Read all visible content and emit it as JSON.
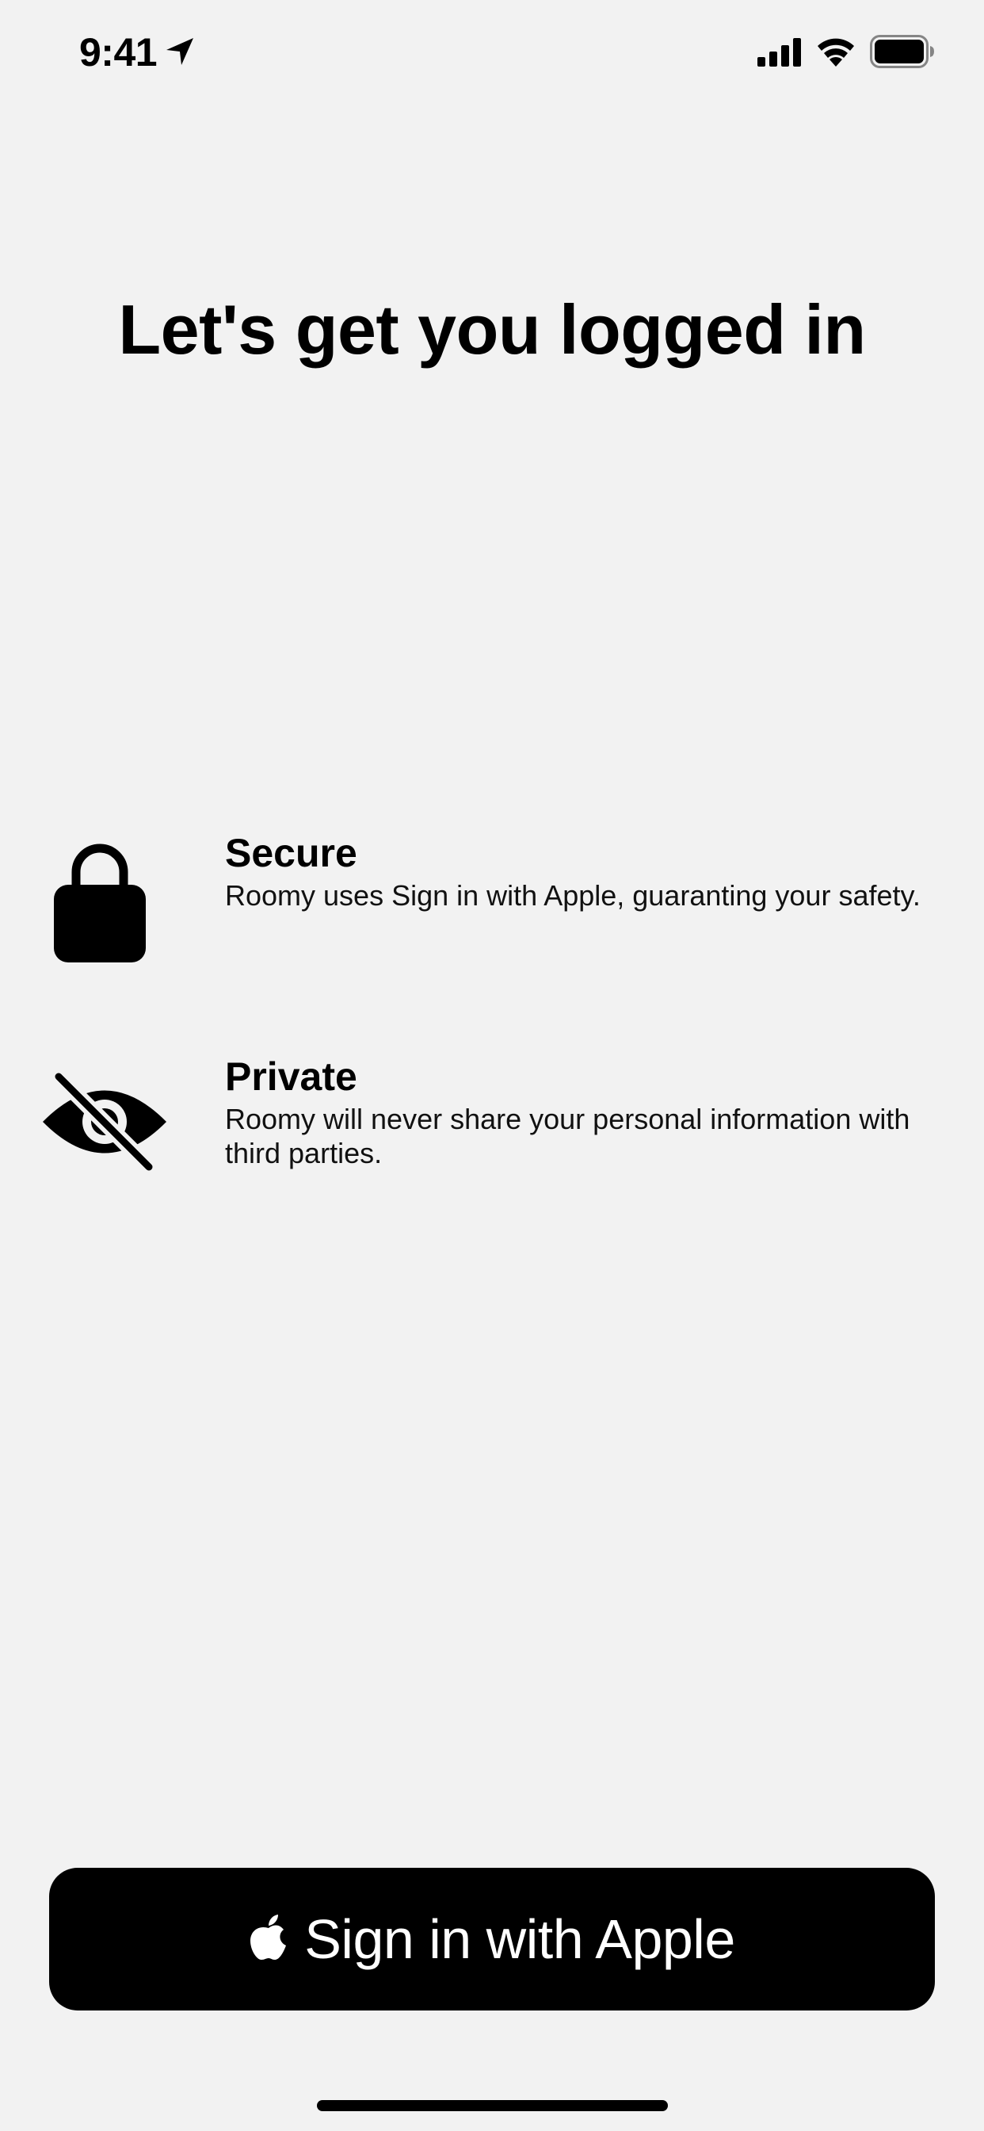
{
  "status_bar": {
    "time": "9:41",
    "icons": [
      "location-arrow-icon",
      "cellular-signal-icon",
      "wifi-icon",
      "battery-icon"
    ]
  },
  "title": "Let's get you logged in",
  "features": [
    {
      "icon": "lock-icon",
      "title": "Secure",
      "description": "Roomy uses Sign in with Apple, guaranting your safety."
    },
    {
      "icon": "eye-slash-icon",
      "title": "Private",
      "description": "Roomy will never share your personal information with third parties."
    }
  ],
  "sign_in_button": {
    "icon": "apple-logo-icon",
    "label": "Sign in with Apple"
  },
  "colors": {
    "background": "#f2f2f2",
    "button_background": "#000000",
    "button_text": "#ffffff",
    "text": "#000000"
  }
}
